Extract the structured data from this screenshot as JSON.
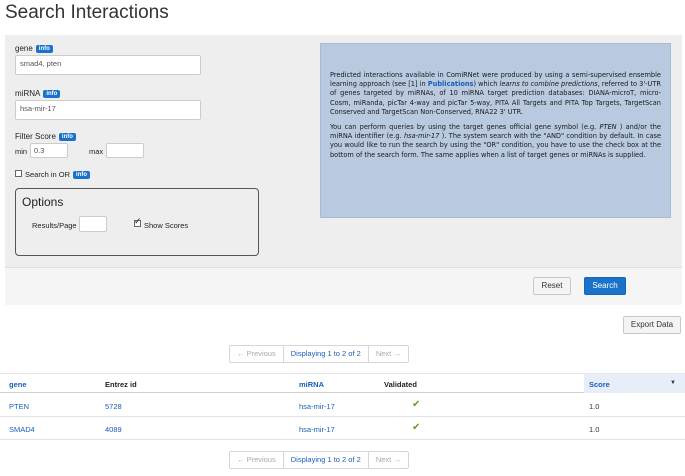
{
  "page": {
    "title": "Search Interactions"
  },
  "form": {
    "gene": {
      "label": "gene",
      "info": "info",
      "value": "smad4, pten"
    },
    "mirna": {
      "label": "miRNA",
      "info": "info",
      "value": "hsa-mir-17"
    },
    "filter_score": {
      "label": "Filter Score",
      "info": "info",
      "min_label": "min",
      "min_value": "0.3",
      "max_label": "max",
      "max_value": ""
    },
    "search_or": {
      "label": "Search in OR",
      "info": "info",
      "checked": false
    },
    "options": {
      "title": "Options",
      "results_per_page_label": "Results/Page",
      "results_per_page_value": "",
      "show_scores_label": "Show Scores",
      "show_scores_checked": true
    },
    "description": {
      "p1_a": "Predicted interactions available in ComiRNet were produced by using a semi-supervised ensemble learning approach (see [1] in ",
      "p1_link": "Publications",
      "p1_b": ") which ",
      "p1_em": "learns to combine predictions",
      "p1_c": ", referred to 3'-UTR of genes targeted by miRNAs, of 10 miRNA target prediction databases: DIANA-microT, micro-Cosm, miRanda, picTar 4-way and picTar 5-way, PITA All Targets and PITA Top Targets, TargetScan Conserved and TargetScan Non-Conserved, RNA22 3' UTR.",
      "p2_a": "You can perform queries by using the target genes official gene symbol (e.g. ",
      "p2_em1": "PTEN",
      "p2_b": " ) and/or the miRNA identifier (e.g. ",
      "p2_em2": "hsa-mir-17",
      "p2_c": " ). The system search with the \"AND\" condition by default. In case you would like to run the search by using the \"OR\" condition, you have to use the check box at the bottom of the search form. The same applies when a list of target genes or miRNAs is supplied."
    },
    "buttons": {
      "reset": "Reset",
      "search": "Search"
    }
  },
  "results": {
    "export_label": "Export Data",
    "pager": {
      "prev": "← Previous",
      "current": "Displaying 1 to 2 of 2",
      "next": "Next →"
    },
    "columns": [
      "gene",
      "Entrez id",
      "miRNA",
      "Validated",
      "Score"
    ],
    "sort_indicator": "▼",
    "rows": [
      {
        "gene": "PTEN",
        "entrez": "5728",
        "mirna": "hsa-mir-17",
        "validated": true,
        "score": "1.0"
      },
      {
        "gene": "SMAD4",
        "entrez": "4089",
        "mirna": "hsa-mir-17",
        "validated": true,
        "score": "1.0"
      }
    ]
  },
  "colors": {
    "accent": "#1a73c9",
    "link": "#1a5fb4",
    "panel": "#eeeeee",
    "description_bg": "#b8c9e0",
    "validated": "#5aa02c"
  },
  "icons": {
    "validated": "check-icon"
  }
}
